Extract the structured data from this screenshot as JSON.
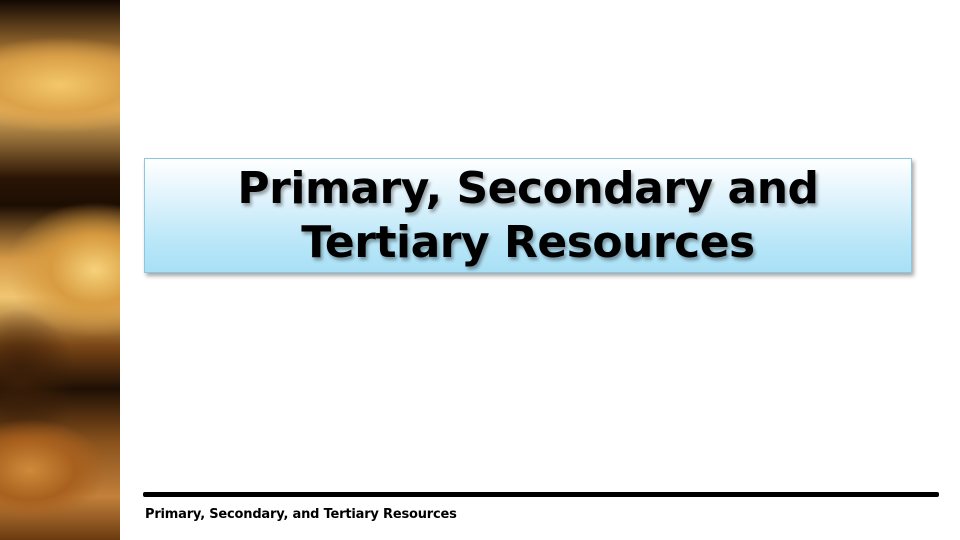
{
  "slide": {
    "title_lines": [
      "Primary, Secondary and",
      "Tertiary Resources"
    ],
    "footer": "Primary, Secondary, and Tertiary Resources"
  },
  "colors": {
    "title_box_top": "#ffffff",
    "title_box_bottom": "#a9e0f6",
    "title_box_border": "#8cc6e0",
    "rule": "#000000",
    "text": "#000000"
  }
}
